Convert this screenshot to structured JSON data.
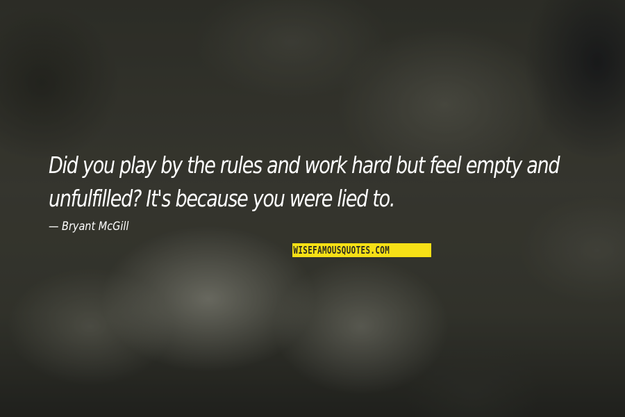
{
  "quote": {
    "lines": [
      "Did you play by the rules and work hard but feel empty and",
      "unfulfilled? It's because you were lied to."
    ]
  },
  "author": "Bryant McGill",
  "watermark": "WISEFAMOUSQUOTES.COM",
  "colors": {
    "text": "#ffffff",
    "watermark_bg": "#f6e016",
    "watermark_text": "#2b2a20"
  }
}
